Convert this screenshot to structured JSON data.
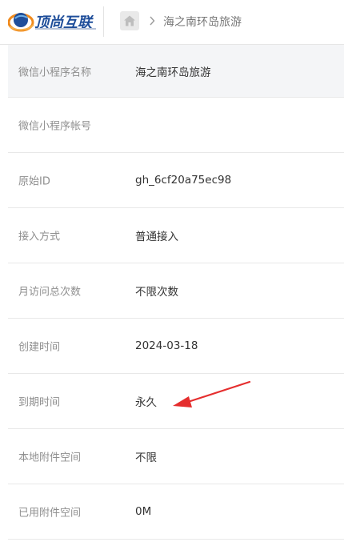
{
  "header": {
    "logo_text": "顶尚互联",
    "breadcrumb": {
      "home_icon": "home-icon",
      "separator_icon": "chevron-right-icon",
      "current": "海之南环岛旅游"
    }
  },
  "fields": [
    {
      "label": "微信小程序名称",
      "value": "海之南环岛旅游"
    },
    {
      "label": "微信小程序帐号",
      "value": ""
    },
    {
      "label": "原始ID",
      "value": "gh_6cf20a75ec98"
    },
    {
      "label": "接入方式",
      "value": "普通接入"
    },
    {
      "label": "月访问总次数",
      "value": "不限次数"
    },
    {
      "label": "创建时间",
      "value": "2024-03-18"
    },
    {
      "label": "到期时间",
      "value": "永久"
    },
    {
      "label": "本地附件空间",
      "value": "不限"
    },
    {
      "label": "已用附件空间",
      "value": "0M"
    }
  ],
  "colors": {
    "brand_blue": "#1f4e9a",
    "brand_orange": "#f08a1c",
    "annotation_arrow": "#e52e2e"
  }
}
